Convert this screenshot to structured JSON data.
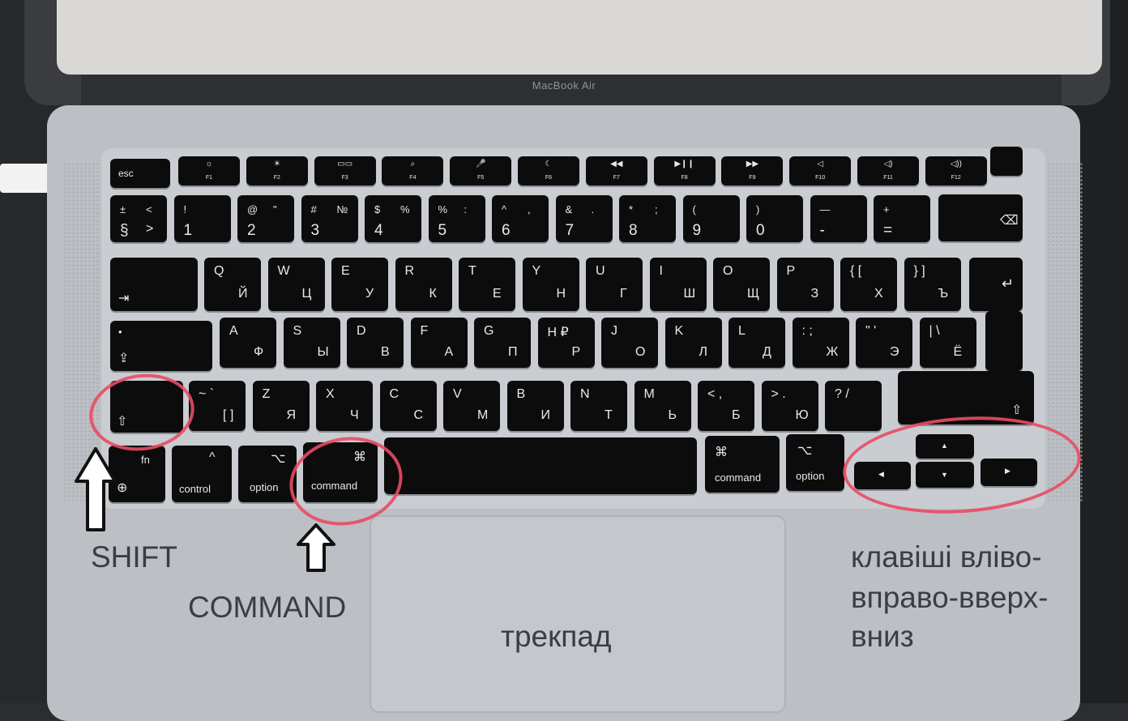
{
  "laptop_model": "MacBook Air",
  "function_row": {
    "esc": "esc",
    "keys": [
      {
        "symbol": "☼",
        "label": "F1"
      },
      {
        "symbol": "☀",
        "label": "F2"
      },
      {
        "symbol": "▭▭",
        "label": "F3"
      },
      {
        "symbol": "⌕",
        "label": "F4"
      },
      {
        "symbol": "🎤",
        "label": "F5"
      },
      {
        "symbol": "☾",
        "label": "F6"
      },
      {
        "symbol": "◀◀",
        "label": "F7"
      },
      {
        "symbol": "▶❙❙",
        "label": "F8"
      },
      {
        "symbol": "▶▶",
        "label": "F9"
      },
      {
        "symbol": "◁",
        "label": "F10"
      },
      {
        "symbol": "◁)",
        "label": "F11"
      },
      {
        "symbol": "◁))",
        "label": "F12"
      }
    ]
  },
  "number_row": [
    {
      "top": "±",
      "bottom": "§",
      "top2": "<",
      "bottom2": ">"
    },
    {
      "top": "!",
      "bottom": "1"
    },
    {
      "top": "@",
      "bottom": "2",
      "top2": "\""
    },
    {
      "top": "#",
      "bottom": "3",
      "top2": "№"
    },
    {
      "top": "$",
      "bottom": "4",
      "top2": "%"
    },
    {
      "top": "%",
      "bottom": "5",
      "top2": ":"
    },
    {
      "top": "^",
      "bottom": "6",
      "top2": ","
    },
    {
      "top": "&",
      "bottom": "7",
      "top2": "."
    },
    {
      "top": "*",
      "bottom": "8",
      "top2": ";"
    },
    {
      "top": "(",
      "bottom": "9"
    },
    {
      "top": ")",
      "bottom": "0"
    },
    {
      "top": "—",
      "bottom": "-"
    },
    {
      "top": "+",
      "bottom": "="
    }
  ],
  "backspace_symbol": "⌫",
  "tab_symbol": "⇥",
  "return_symbol": "↵",
  "caps_symbol": "⇪",
  "caps_dot": "•",
  "shift_symbol": "⇧",
  "row_q": [
    {
      "lat": "Q",
      "cyr": "Й"
    },
    {
      "lat": "W",
      "cyr": "Ц"
    },
    {
      "lat": "E",
      "cyr": "У"
    },
    {
      "lat": "R",
      "cyr": "К"
    },
    {
      "lat": "T",
      "cyr": "Е"
    },
    {
      "lat": "Y",
      "cyr": "Н"
    },
    {
      "lat": "U",
      "cyr": "Г"
    },
    {
      "lat": "I",
      "cyr": "Ш"
    },
    {
      "lat": "O",
      "cyr": "Щ"
    },
    {
      "lat": "P",
      "cyr": "З"
    },
    {
      "lat": "{ [",
      "cyr": "Х"
    },
    {
      "lat": "} ]",
      "cyr": "Ъ"
    }
  ],
  "row_a": [
    {
      "lat": "A",
      "cyr": "Ф"
    },
    {
      "lat": "S",
      "cyr": "Ы"
    },
    {
      "lat": "D",
      "cyr": "В"
    },
    {
      "lat": "F",
      "cyr": "А"
    },
    {
      "lat": "G",
      "cyr": "П"
    },
    {
      "lat": "H ₽",
      "cyr": "Р"
    },
    {
      "lat": "J",
      "cyr": "О"
    },
    {
      "lat": "K",
      "cyr": "Л"
    },
    {
      "lat": "L",
      "cyr": "Д"
    },
    {
      "lat": ": ;",
      "cyr": "Ж"
    },
    {
      "lat": "\" '",
      "cyr": "Э"
    },
    {
      "lat": "| \\",
      "cyr": "Ё"
    }
  ],
  "row_z": [
    {
      "lat": "~ `",
      "cyr": "[ ]"
    },
    {
      "lat": "Z",
      "cyr": "Я"
    },
    {
      "lat": "X",
      "cyr": "Ч"
    },
    {
      "lat": "C",
      "cyr": "С"
    },
    {
      "lat": "V",
      "cyr": "М"
    },
    {
      "lat": "B",
      "cyr": "И"
    },
    {
      "lat": "N",
      "cyr": "Т"
    },
    {
      "lat": "M",
      "cyr": "Ь"
    },
    {
      "lat": "< ,",
      "cyr": "Б"
    },
    {
      "lat": "> .",
      "cyr": "Ю"
    },
    {
      "lat": "? /",
      "cyr": ""
    }
  ],
  "bottom_row": {
    "fn": "fn",
    "globe": "⊕",
    "control_symbol": "^",
    "control": "control",
    "option_symbol": "⌥",
    "option": "option",
    "command_symbol": "⌘",
    "command": "command",
    "arrow_up": "▲",
    "arrow_down": "▼",
    "arrow_left": "◀",
    "arrow_right": "▶"
  },
  "annotations": {
    "shift": "SHIFT",
    "command": "COMMAND",
    "trackpad": "трекпад",
    "arrows_line1": "клавіші вліво-",
    "arrows_line2": "вправо-вверх-",
    "arrows_line3": "вниз"
  },
  "colors": {
    "highlight": "#e84b63",
    "key": "#0c0c0d",
    "chassis": "#bcbfc3"
  }
}
